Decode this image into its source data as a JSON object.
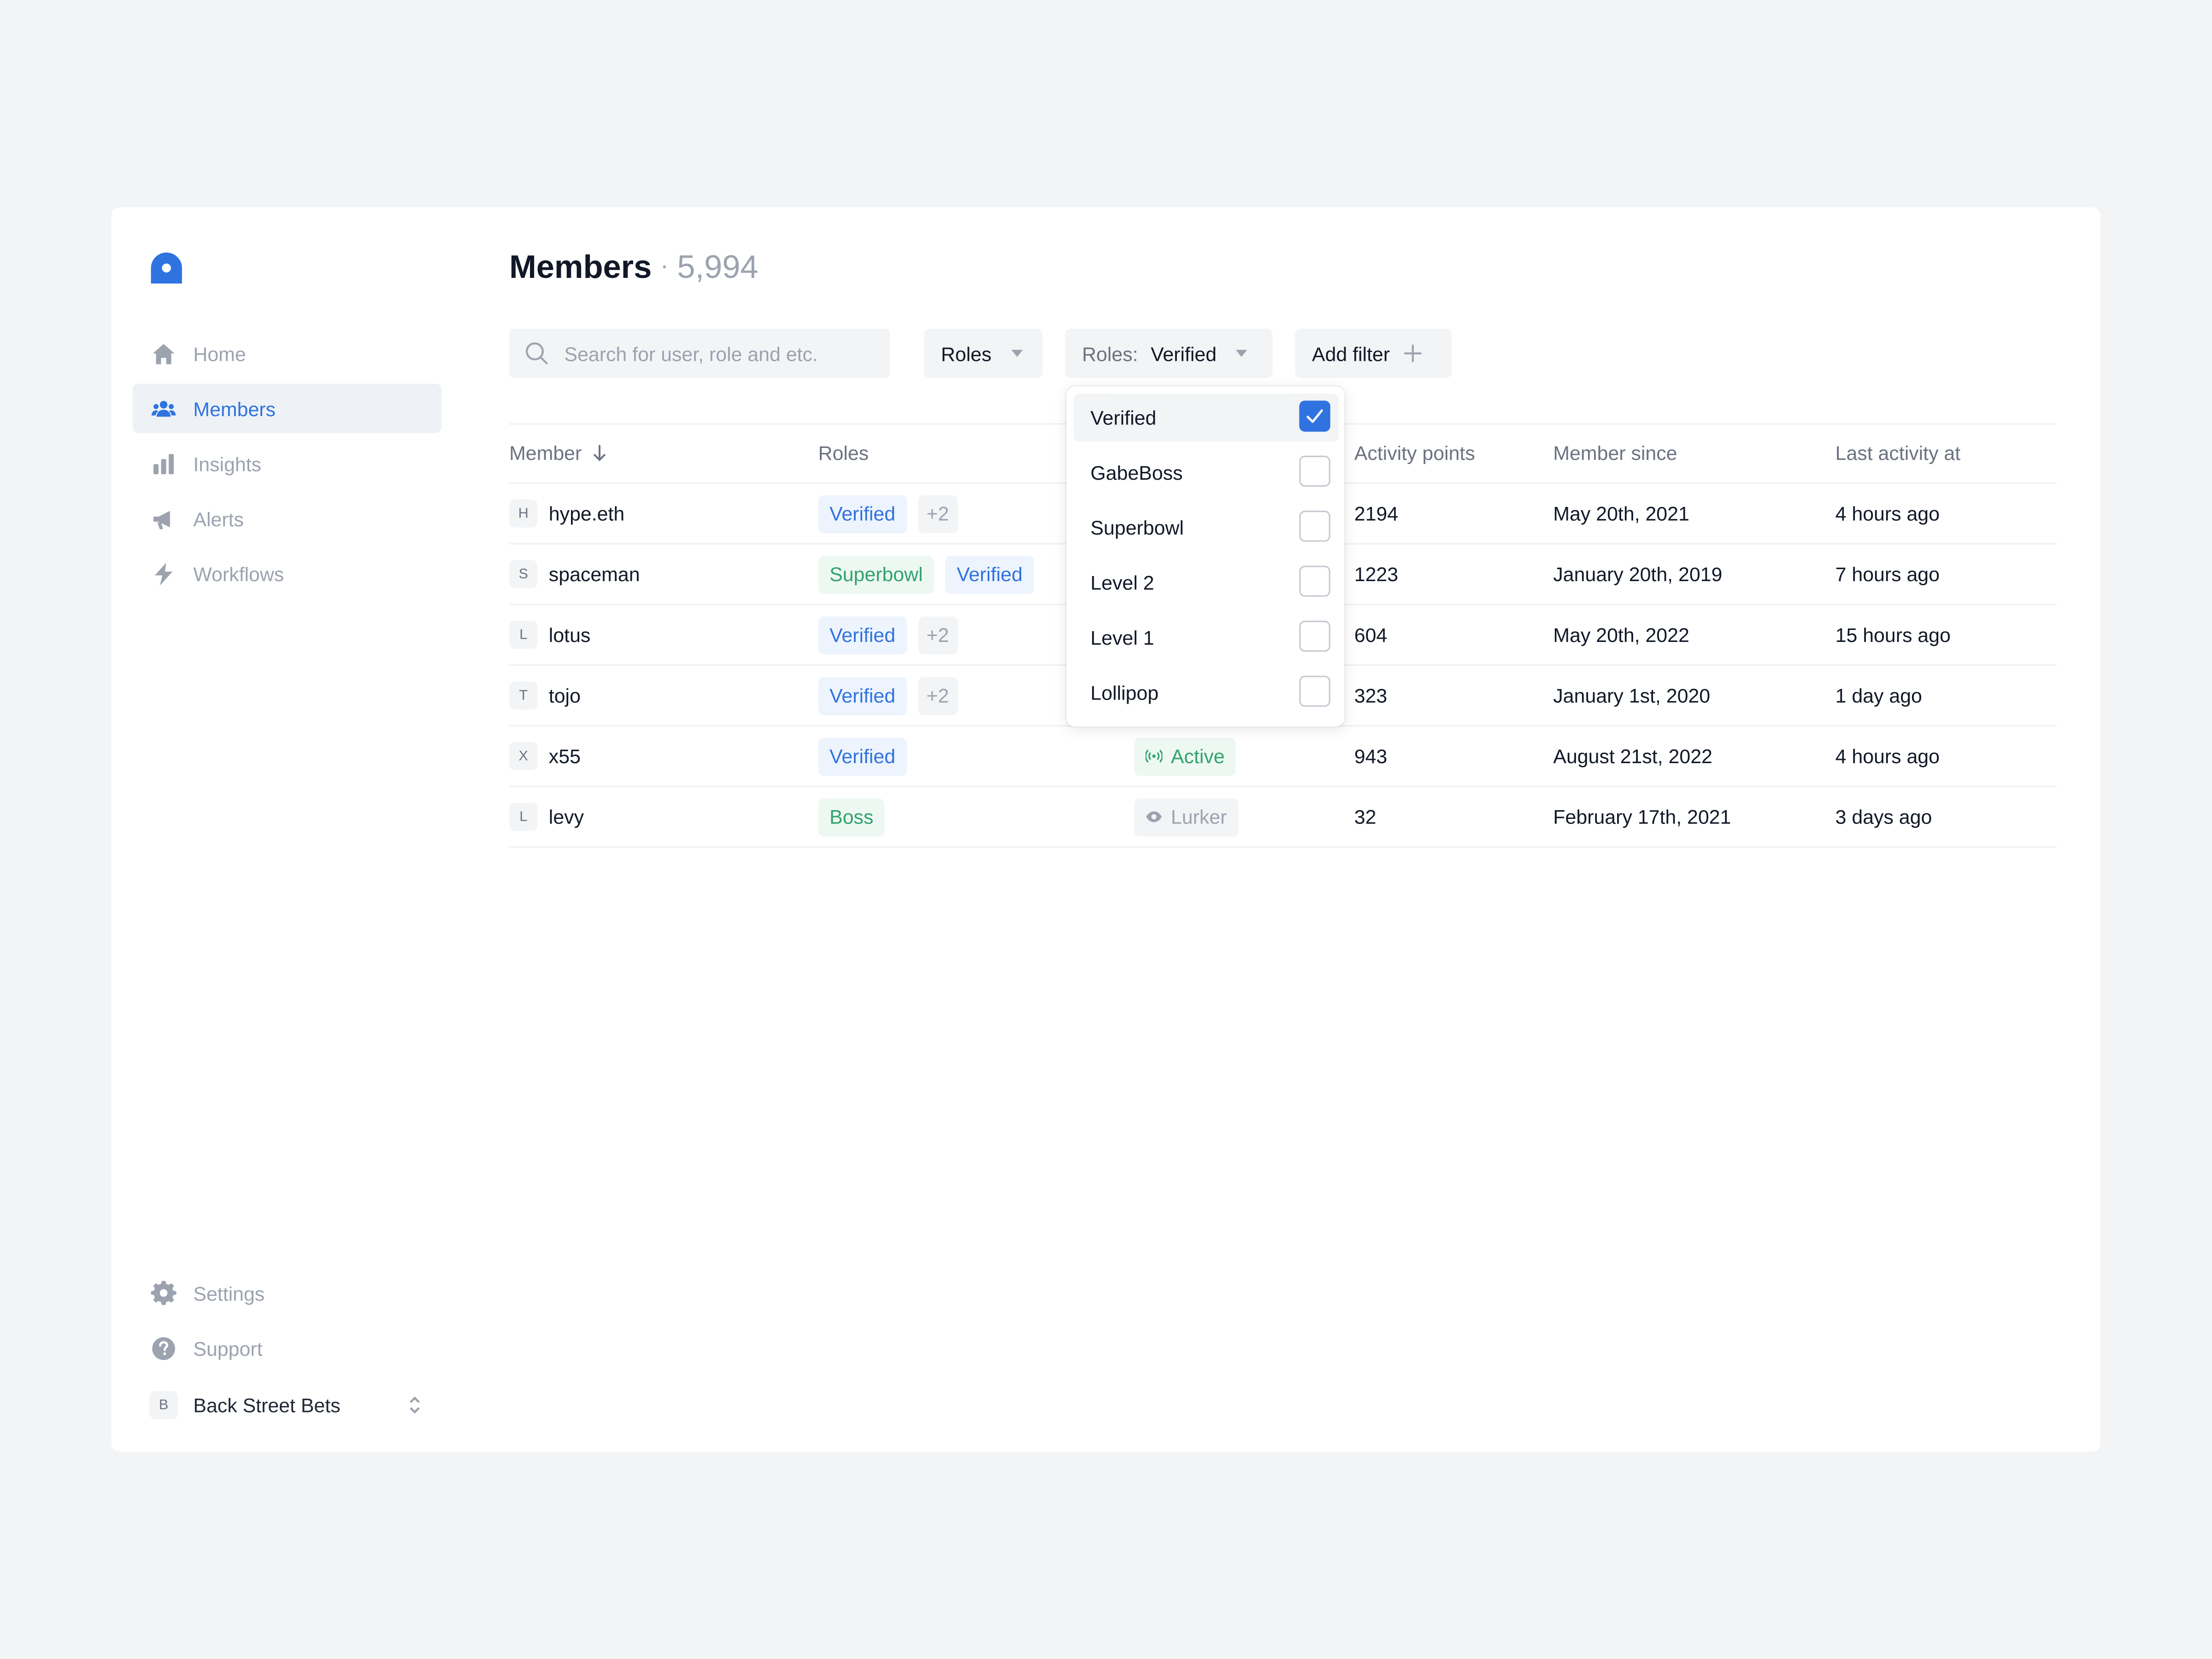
{
  "sidebar": {
    "items": [
      {
        "label": "Home",
        "icon": "home-icon"
      },
      {
        "label": "Members",
        "icon": "users-icon"
      },
      {
        "label": "Insights",
        "icon": "bar-chart-icon"
      },
      {
        "label": "Alerts",
        "icon": "megaphone-icon"
      },
      {
        "label": "Workflows",
        "icon": "bolt-icon"
      }
    ],
    "bottom_items": [
      {
        "label": "Settings",
        "icon": "gear-icon"
      },
      {
        "label": "Support",
        "icon": "question-icon"
      }
    ],
    "workspace": {
      "initial": "B",
      "name": "Back Street Bets"
    }
  },
  "header": {
    "title": "Members",
    "separator": "·",
    "count": "5,994"
  },
  "toolbar": {
    "search_placeholder": "Search for user, role and etc.",
    "roles_button": "Roles",
    "active_filter": {
      "label": "Roles:",
      "value": "Verified"
    },
    "add_filter": "Add filter"
  },
  "table": {
    "columns": [
      "Member",
      "Roles",
      "Activity points",
      "Member since",
      "Last activity at"
    ],
    "rows": [
      {
        "initial": "H",
        "name": "hype.eth",
        "roles": [
          "Verified"
        ],
        "more": "+2",
        "status": "",
        "points": "2194",
        "since": "May 20th, 2021",
        "last": "4 hours ago"
      },
      {
        "initial": "S",
        "name": "spaceman",
        "roles": [
          "Superbowl",
          "Verified"
        ],
        "more": "",
        "status": "",
        "points": "1223",
        "since": "January 20th, 2019",
        "last": "7 hours ago"
      },
      {
        "initial": "L",
        "name": "lotus",
        "roles": [
          "Verified"
        ],
        "more": "+2",
        "status": "",
        "points": "604",
        "since": "May 20th, 2022",
        "last": "15 hours ago"
      },
      {
        "initial": "T",
        "name": "tojo",
        "roles": [
          "Verified"
        ],
        "more": "+2",
        "status": "",
        "points": "323",
        "since": "January 1st, 2020",
        "last": "1 day ago"
      },
      {
        "initial": "X",
        "name": "x55",
        "roles": [
          "Verified"
        ],
        "more": "",
        "status": "Active",
        "points": "943",
        "since": "August 21st, 2022",
        "last": "4 hours ago"
      },
      {
        "initial": "L",
        "name": "levy",
        "roles": [
          "Boss"
        ],
        "more": "",
        "status": "Lurker",
        "points": "32",
        "since": "February 17th, 2021",
        "last": "3 days ago"
      }
    ]
  },
  "dropdown": {
    "options": [
      {
        "label": "Verified",
        "checked": true
      },
      {
        "label": "GabeBoss",
        "checked": false
      },
      {
        "label": "Superbowl",
        "checked": false
      },
      {
        "label": "Level 2",
        "checked": false
      },
      {
        "label": "Level 1",
        "checked": false
      },
      {
        "label": "Lollipop",
        "checked": false
      }
    ]
  },
  "colors": {
    "accent": "#2f73e0",
    "success": "#31a36c",
    "muted": "#9ca3af",
    "background": "#f3f4f6"
  }
}
